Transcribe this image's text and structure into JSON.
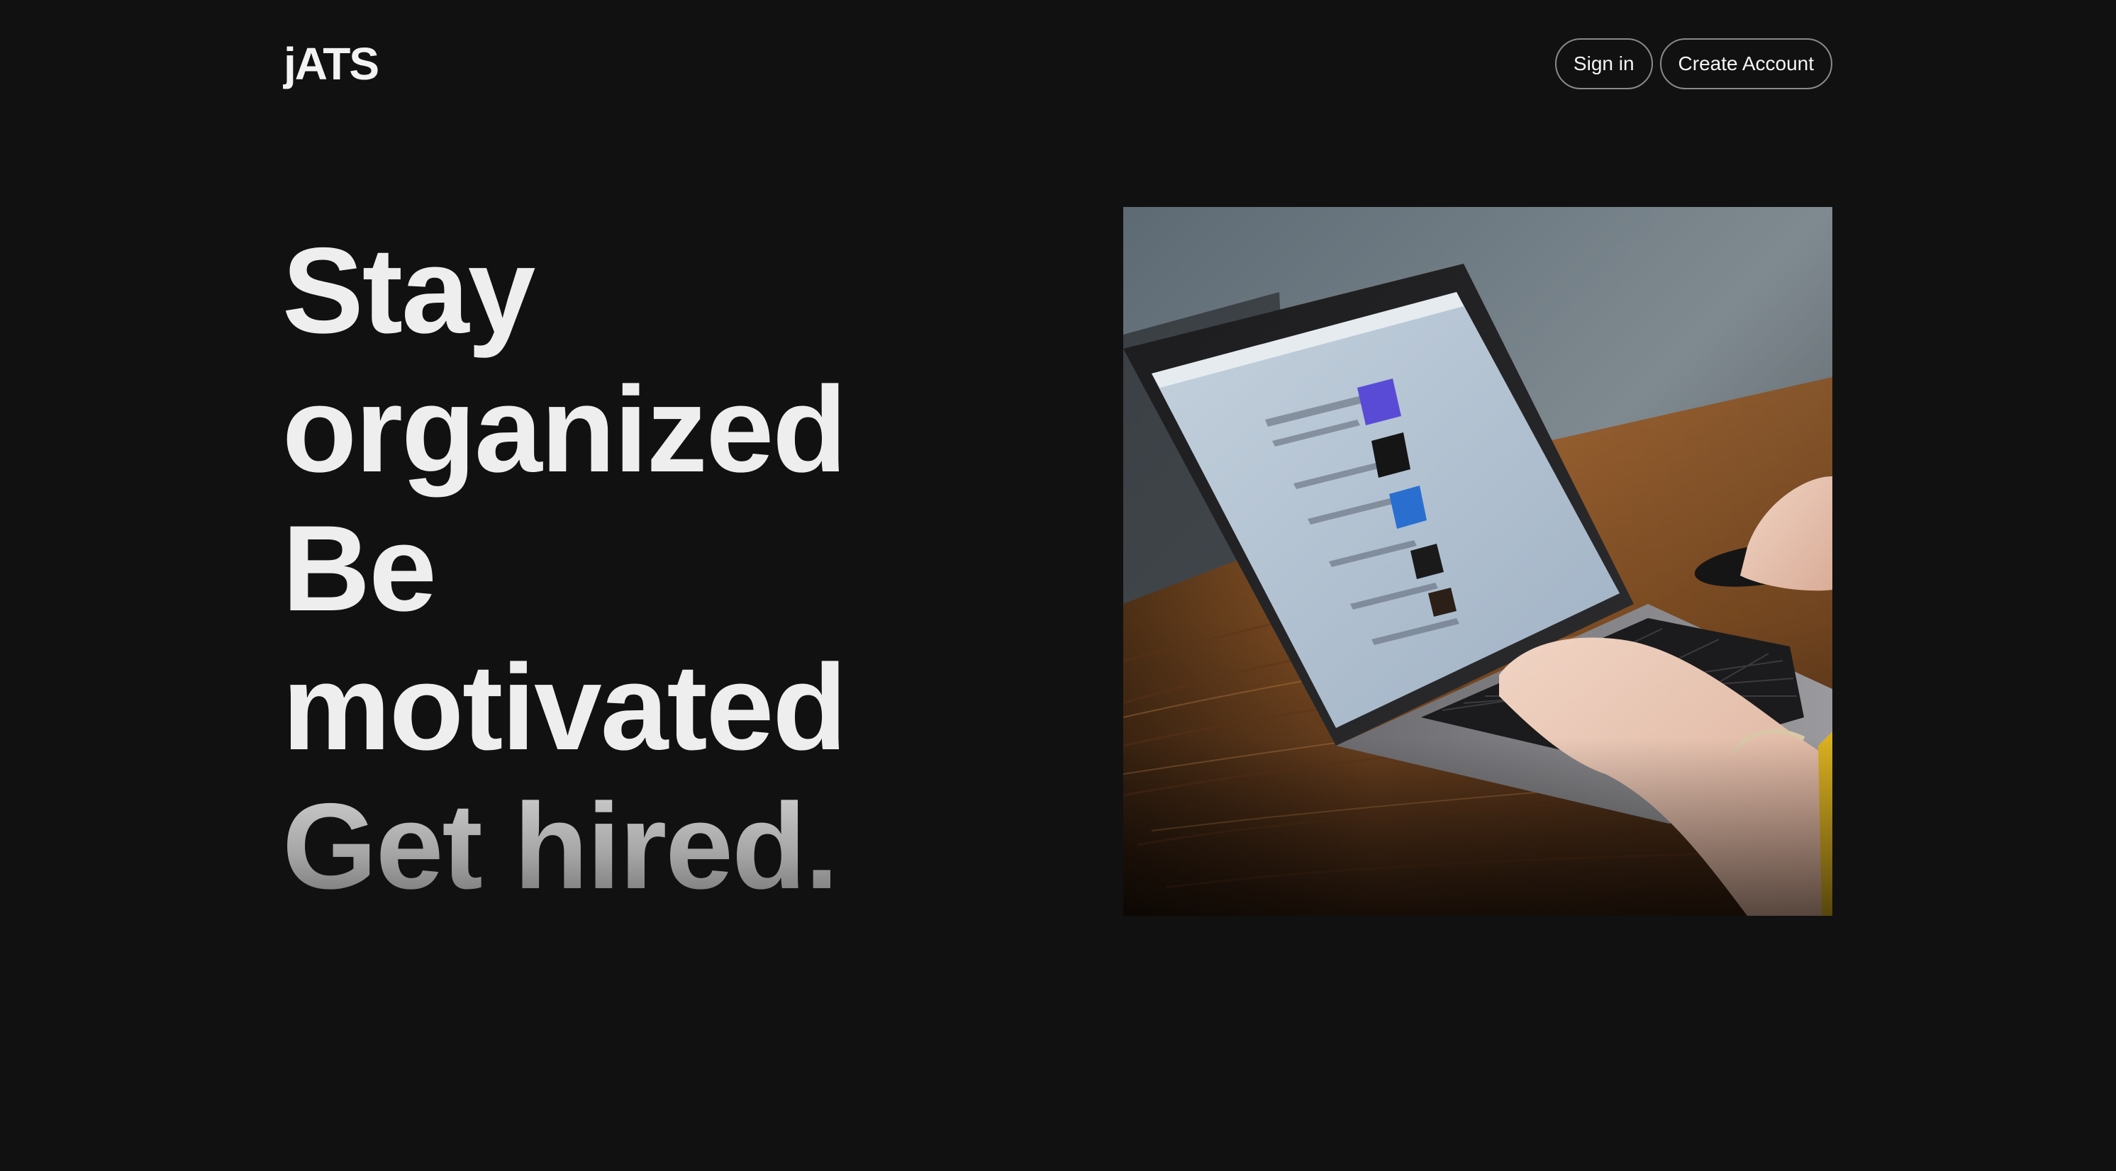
{
  "header": {
    "logo": "jATS",
    "sign_in_label": "Sign in",
    "create_account_label": "Create Account"
  },
  "hero": {
    "lines": [
      "Stay",
      "organized",
      "Be",
      "motivated",
      "Get hired."
    ]
  },
  "colors": {
    "background": "#111111",
    "text": "#eeeeee",
    "button_border": "#8a8a8a"
  }
}
